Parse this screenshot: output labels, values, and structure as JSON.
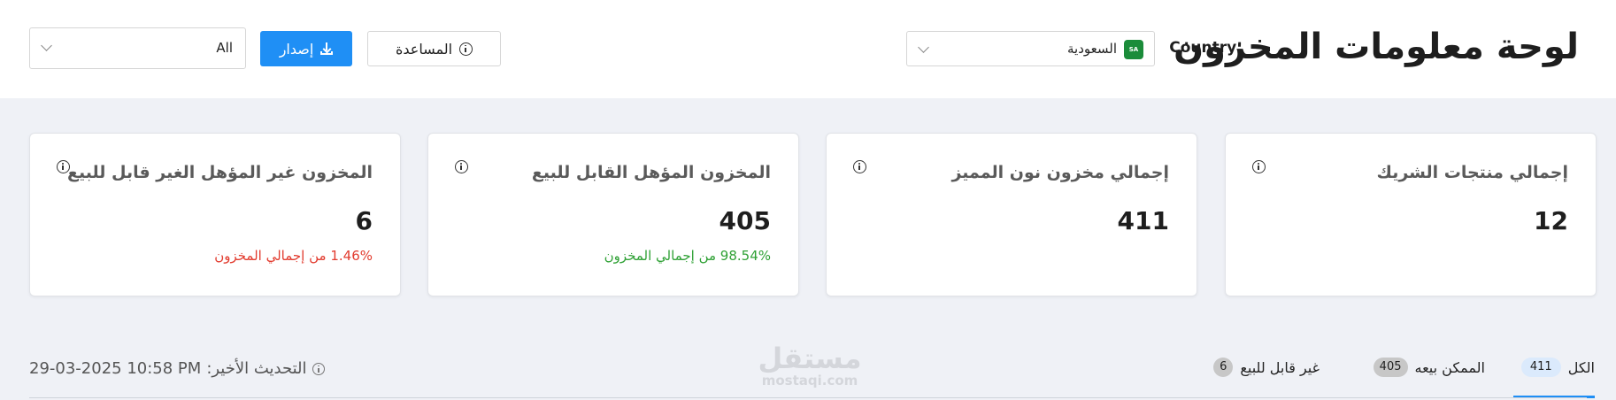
{
  "header": {
    "title": "لوحة معلومات المخزون",
    "country_label": "Country:",
    "country_value": "السعودية",
    "country_flag_text": "SA",
    "help_label": "المساعدة",
    "export_label": "إصدار",
    "filter_value": "All"
  },
  "cards": [
    {
      "title": "إجمالي منتجات الشريك",
      "value": "12",
      "sub": "",
      "sub_color": "#222222"
    },
    {
      "title": "إجمالي مخزون نون المميز",
      "value": "411",
      "sub": "",
      "sub_color": "#222222"
    },
    {
      "title": "المخزون المؤهل القابل للبيع",
      "value": "405",
      "sub": "98.54% من إجمالي المخزون",
      "sub_color": "#2fa135"
    },
    {
      "title": "المخزون غير المؤهل الغير قابل للبيع",
      "value": "6",
      "sub": "1.46% من إجمالي المخزون",
      "sub_color": "#e23b2e"
    }
  ],
  "tabs": [
    {
      "label": "الكل",
      "count": "411",
      "active": true
    },
    {
      "label": "الممكن بيعه",
      "count": "405",
      "active": false
    },
    {
      "label": "غير قابل للبيع",
      "count": "6",
      "active": false
    }
  ],
  "last_update": {
    "label": "التحديث الأخير:",
    "value": "29-03-2025 10:58 PM"
  },
  "watermark": {
    "arabic": "مستقل",
    "latin": "mostaqi.com"
  },
  "colors": {
    "accent": "#1f8ff5",
    "success": "#2fa135",
    "danger": "#e23b2e"
  }
}
